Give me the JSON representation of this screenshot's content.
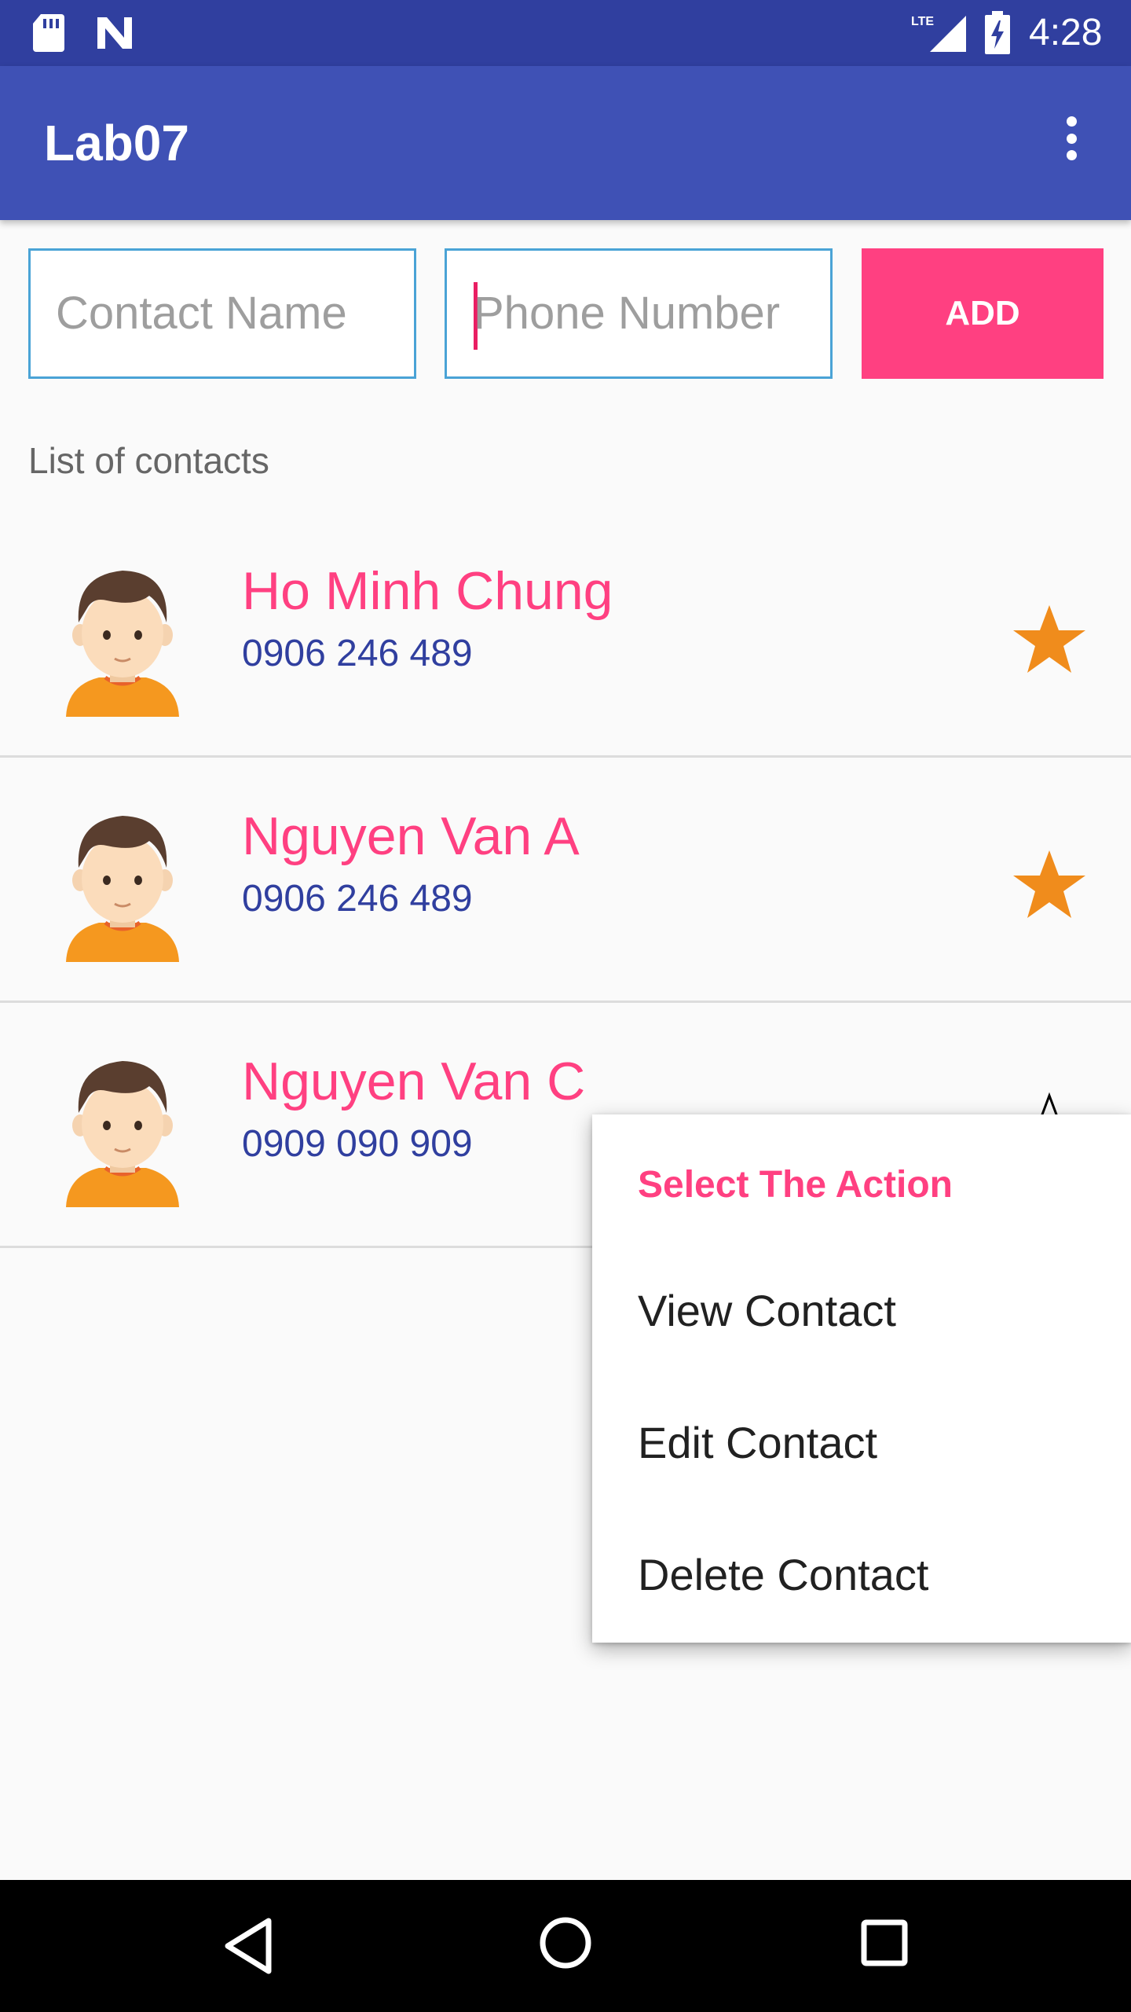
{
  "status_bar": {
    "time": "4:28",
    "network": "LTE"
  },
  "app_bar": {
    "title": "Lab07",
    "menu_icon": "more-vert-icon"
  },
  "form": {
    "contact_name_placeholder": "Contact Name",
    "phone_number_placeholder": "Phone Number",
    "add_label": "ADD"
  },
  "list_label": "List of contacts",
  "contacts": [
    {
      "name": "Ho Minh Chung",
      "phone": "0906 246 489",
      "favorite": true
    },
    {
      "name": "Nguyen Van A",
      "phone": "0906 246 489",
      "favorite": true
    },
    {
      "name": "Nguyen Van C",
      "phone": "0909 090 909",
      "favorite": false
    }
  ],
  "context_menu": {
    "title": "Select The Action",
    "items": [
      "View Contact",
      "Edit Contact",
      "Delete Contact"
    ]
  },
  "colors": {
    "primary": "#3f51b5",
    "primary_dark": "#303f9f",
    "accent": "#ff4081",
    "star": "#f08c1c"
  }
}
